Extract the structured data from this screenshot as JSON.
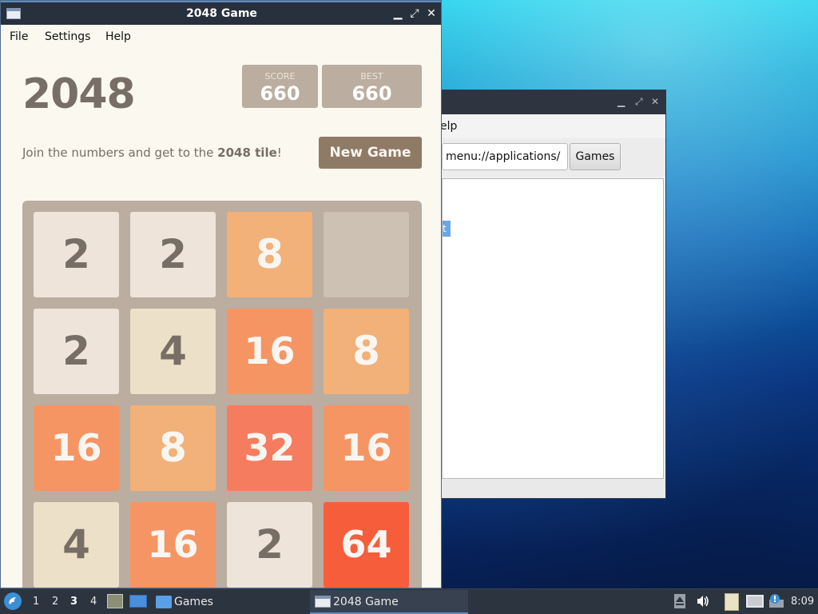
{
  "game_window": {
    "title": "2048 Game",
    "controls": {
      "minimize": "▁",
      "restore": "⤢",
      "close": "✕"
    },
    "menu": [
      "File",
      "Settings",
      "Help"
    ]
  },
  "game": {
    "title": "2048",
    "score_label": "SCORE",
    "score": "660",
    "best_label": "BEST",
    "best": "660",
    "intro_prefix": "Join the numbers and get to the ",
    "intro_bold": "2048 tile",
    "intro_suffix": "!",
    "new_game_label": "New Game",
    "grid": [
      [
        2,
        2,
        8,
        null
      ],
      [
        2,
        4,
        16,
        8
      ],
      [
        16,
        8,
        32,
        16
      ],
      [
        4,
        16,
        2,
        64
      ]
    ],
    "tile_colors": {
      "empty": "#cdc1b4",
      "2": {
        "bg": "#eee4da",
        "fg": "#776e65"
      },
      "4": {
        "bg": "#ede0c8",
        "fg": "#776e65"
      },
      "8": {
        "bg": "#f2b179",
        "fg": "#f9f6f2"
      },
      "16": {
        "bg": "#f59563",
        "fg": "#f9f6f2"
      },
      "32": {
        "bg": "#f67c5f",
        "fg": "#f9f6f2"
      },
      "64": {
        "bg": "#f65e3b",
        "fg": "#f9f6f2"
      }
    }
  },
  "background_window": {
    "menu_fragment": "elp",
    "path_value": "menu://applications/",
    "crumb_button": "Games",
    "selected_fragment": "t"
  },
  "taskbar": {
    "workspaces": [
      "1",
      "2",
      "3",
      "4"
    ],
    "active_workspace": "3",
    "tasks": [
      {
        "label": "Games",
        "icon": "folder-icon"
      },
      {
        "label": "2048 Game",
        "icon": "window-icon"
      }
    ],
    "clock": "8:09"
  }
}
